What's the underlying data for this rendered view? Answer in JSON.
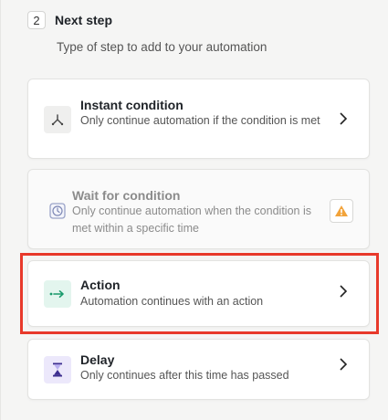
{
  "step": {
    "number": "2",
    "title": "Next step",
    "subtitle": "Type of step to add to your automation"
  },
  "options": [
    {
      "title": "Instant condition",
      "description": "Only continue automation if the condition is met",
      "icon": "branch-icon",
      "disabled": false
    },
    {
      "title": "Wait for condition",
      "description": "Only continue automation when the condition is met within a specific time",
      "icon": "clock-icon",
      "disabled": true,
      "status_icon": "warning-icon"
    },
    {
      "title": "Action",
      "description": "Automation continues with an action",
      "icon": "arrow-right-icon",
      "disabled": false,
      "highlighted": true
    },
    {
      "title": "Delay",
      "description": "Only continues after this time has passed",
      "icon": "hourglass-icon",
      "disabled": false
    }
  ],
  "colors": {
    "highlight": "#e8392b",
    "action_icon_bg": "#e3f5ee",
    "action_icon": "#1a9a6c",
    "delay_icon_bg": "#ece8fb",
    "delay_icon": "#3d2e8f",
    "warning": "#f2a33a"
  }
}
